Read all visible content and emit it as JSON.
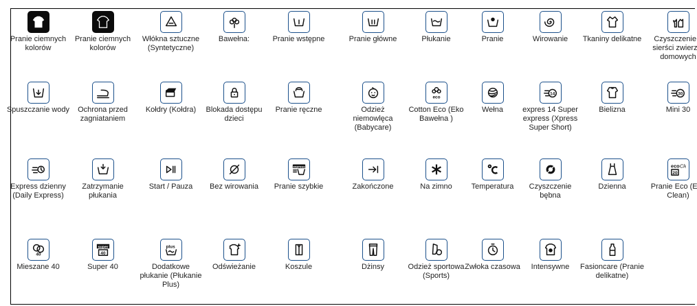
{
  "rows": [
    [
      {
        "label": "Pranie ciemnych kolorów",
        "icon": "tshirt-dark-icon",
        "style": "dark",
        "glyph": "tshirt"
      },
      {
        "label": "Pranie ciemnych kolorów",
        "icon": "tshirt-outline-dark-icon",
        "style": "dark",
        "glyph": "tshirt-outline"
      },
      {
        "label": "Włókna sztuczne (Syntetyczne)",
        "icon": "synthetic-triangle-icon",
        "style": "light",
        "glyph": "triangle"
      },
      {
        "label": "Bawełna:",
        "icon": "cotton-flower-icon",
        "style": "light",
        "glyph": "flower"
      },
      {
        "label": "Pranie wstępne",
        "icon": "prewash-tub-icon",
        "style": "light",
        "glyph": "tub1"
      },
      {
        "label": "Pranie główne",
        "icon": "mainwash-tub-icon",
        "style": "light",
        "glyph": "tub2"
      },
      {
        "label": "Płukanie",
        "icon": "rinse-tub-icon",
        "style": "light",
        "glyph": "tubwave"
      },
      {
        "label": "Pranie",
        "icon": "wash-icon",
        "style": "light",
        "glyph": "wash"
      },
      {
        "label": "Wirowanie",
        "icon": "spin-spiral-icon",
        "style": "light",
        "glyph": "spiral"
      },
      {
        "label": "Tkaniny delikatne",
        "icon": "delicates-icon",
        "style": "light",
        "glyph": "blouse"
      },
      {
        "label": "Czyszczenie z sierści zwierząt domowych",
        "icon": "pet-hair-icon",
        "style": "light",
        "glyph": "pet"
      }
    ],
    [
      {
        "label": "Spuszczanie wody",
        "icon": "drain-icon",
        "style": "light",
        "glyph": "drain"
      },
      {
        "label": "Ochrona przed zagniataniem",
        "icon": "anti-crease-iron-icon",
        "style": "light",
        "glyph": "iron"
      },
      {
        "label": "Kołdry (Kołdra)",
        "icon": "duvet-icon",
        "style": "light",
        "glyph": "duvet"
      },
      {
        "label": "Blokada dostępu dzieci",
        "icon": "child-lock-icon",
        "style": "light",
        "glyph": "lock"
      },
      {
        "label": "Pranie ręczne",
        "icon": "hand-wash-icon",
        "style": "light",
        "glyph": "hand"
      },
      {
        "label": "Odzież niemowlęca (Babycare)",
        "icon": "babycare-icon",
        "style": "light",
        "glyph": "baby"
      },
      {
        "label": "Cotton Eco (Eko Bawełna )",
        "icon": "cotton-eco-icon",
        "style": "light",
        "glyph": "eco"
      },
      {
        "label": "Wełna",
        "icon": "wool-icon",
        "style": "light",
        "glyph": "wool"
      },
      {
        "label": "expres 14 Super express (Xpress Super Short)",
        "icon": "express-14-icon",
        "style": "light",
        "glyph": "x14"
      },
      {
        "label": "Bielizna",
        "icon": "underwear-icon",
        "style": "light",
        "glyph": "shirt"
      },
      {
        "label": "Mini 30",
        "icon": "mini-30-icon",
        "style": "light",
        "glyph": "m30"
      }
    ],
    [
      {
        "label": "Express dzienny (Daily Express)",
        "icon": "daily-express-icon",
        "style": "light",
        "glyph": "daily"
      },
      {
        "label": "Zatrzymanie płukania",
        "icon": "rinse-hold-icon",
        "style": "light",
        "glyph": "hold"
      },
      {
        "label": "Start / Pauza",
        "icon": "start-pause-icon",
        "style": "light",
        "glyph": "play"
      },
      {
        "label": "Bez wirowania",
        "icon": "no-spin-icon",
        "style": "light",
        "glyph": "nospin"
      },
      {
        "label": "Pranie szybkie",
        "icon": "quick-wash-icon",
        "style": "light",
        "glyph": "express"
      },
      {
        "label": "Zakończone",
        "icon": "end-icon",
        "style": "light",
        "glyph": "end"
      },
      {
        "label": "Na zimno",
        "icon": "cold-snowflake-icon",
        "style": "light",
        "glyph": "snow"
      },
      {
        "label": "Temperatura",
        "icon": "temperature-icon",
        "style": "light",
        "glyph": "celsius"
      },
      {
        "label": "Czyszczenie bębna",
        "icon": "drum-clean-icon",
        "style": "light",
        "glyph": "drum"
      },
      {
        "label": "Dzienna",
        "icon": "daily-wear-icon",
        "style": "light",
        "glyph": "dress"
      },
      {
        "label": "Pranie Eco (Eco Clean)",
        "icon": "eco-clean-icon",
        "style": "light",
        "glyph": "ecoclean"
      }
    ],
    [
      {
        "label": "Mieszane 40",
        "icon": "mixed-40-icon",
        "style": "light",
        "glyph": "mix40"
      },
      {
        "label": "Super 40",
        "icon": "super-40-icon",
        "style": "light",
        "glyph": "super40"
      },
      {
        "label": "Dodatkowe płukanie (Płukanie Plus)",
        "icon": "rinse-plus-icon",
        "style": "light",
        "glyph": "plus"
      },
      {
        "label": "Odświeżanie",
        "icon": "refresh-icon",
        "style": "light",
        "glyph": "refresh"
      },
      {
        "label": "Koszule",
        "icon": "shirts-icon",
        "style": "light",
        "glyph": "shirts"
      },
      {
        "label": "Dżinsy",
        "icon": "jeans-icon",
        "style": "light",
        "glyph": "jeans"
      },
      {
        "label": "Odzież sportowa (Sports)",
        "icon": "sports-icon",
        "style": "light",
        "glyph": "sports"
      },
      {
        "label": "Zwłoka czasowa",
        "icon": "delay-timer-icon",
        "style": "light",
        "glyph": "timer"
      },
      {
        "label": "Intensywne",
        "icon": "intensive-icon",
        "style": "light",
        "glyph": "intense"
      },
      {
        "label": "Fasioncare (Pranie delikatne)",
        "icon": "fashioncare-icon",
        "style": "light",
        "glyph": "bottle"
      }
    ]
  ],
  "glyph_text": {
    "x14": "14",
    "m30": "30",
    "express": "express",
    "eco_word": "eco",
    "clean_word": "Clean",
    "eco_num": "20",
    "mix40": "40",
    "super_word": "super",
    "super_num": "40",
    "plus_word": "plus"
  }
}
